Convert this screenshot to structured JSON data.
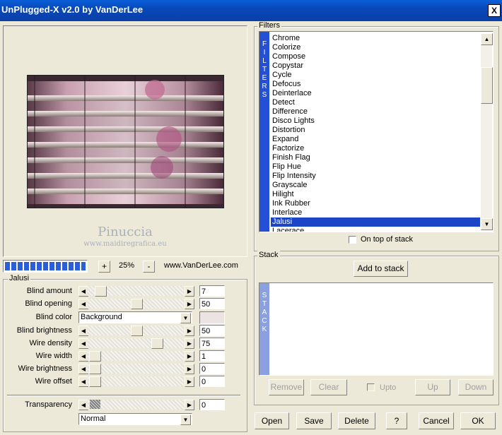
{
  "window": {
    "title": "UnPlugged-X v2.0 by VanDerLee",
    "close_label": "X"
  },
  "preview": {
    "watermark_name": "Pinuccia",
    "watermark_url": "www.maidiregrafica.eu"
  },
  "zoom": {
    "minus": "-",
    "plus": "+",
    "value": "25%",
    "progress_fraction": 1.0
  },
  "site_link": "www.VanDerLee.com",
  "params_group": {
    "legend": "Jalusi",
    "sliders": [
      {
        "label": "Blind amount",
        "value": "7",
        "fraction": 0.07
      },
      {
        "label": "Blind opening",
        "value": "50",
        "fraction": 0.5
      },
      {
        "label": "Blind brightness",
        "value": "50",
        "fraction": 0.5
      },
      {
        "label": "Wire density",
        "value": "75",
        "fraction": 0.75
      },
      {
        "label": "Wire width",
        "value": "1",
        "fraction": 0.0
      },
      {
        "label": "Wire brightness",
        "value": "0",
        "fraction": 0.0
      },
      {
        "label": "Wire offset",
        "value": "0",
        "fraction": 0.0
      }
    ],
    "blind_color": {
      "label": "Blind color",
      "value": "Background",
      "swatch": "#ece4e2"
    },
    "transparency": {
      "label": "Transparency",
      "value": "0",
      "fraction": 0.0
    },
    "blend_mode": "Normal"
  },
  "filters": {
    "legend": "Filters",
    "strip_letters": [
      "F",
      "I",
      "L",
      "T",
      "E",
      "R",
      "S"
    ],
    "items": [
      "Chrome",
      "Colorize",
      "Compose",
      "Copystar",
      "Cycle",
      "Defocus",
      "Deinterlace",
      "Detect",
      "Difference",
      "Disco Lights",
      "Distortion",
      "Expand",
      "Factorize",
      "Finish Flag",
      "Flip Hue",
      "Flip Intensity",
      "Grayscale",
      "Hilight",
      "Ink Rubber",
      "Interlace",
      "Jalusi",
      "Lacerace"
    ],
    "selected": "Jalusi",
    "on_top_label": "On top of stack"
  },
  "stack": {
    "legend": "Stack",
    "add_label": "Add to stack",
    "strip_letters": [
      "S",
      "T",
      "A",
      "C",
      "K"
    ],
    "remove_label": "Remove",
    "clear_label": "Clear",
    "upto_label": "Upto",
    "up_label": "Up",
    "down_label": "Down"
  },
  "footer": {
    "open": "Open",
    "save": "Save",
    "delete": "Delete",
    "help": "?",
    "cancel": "Cancel",
    "ok": "OK"
  },
  "colors": {
    "title_bar": "#0a5fd8",
    "selection": "#1c44c6",
    "filters_strip": "#2450d8",
    "stack_strip": "#8aa0e0"
  }
}
